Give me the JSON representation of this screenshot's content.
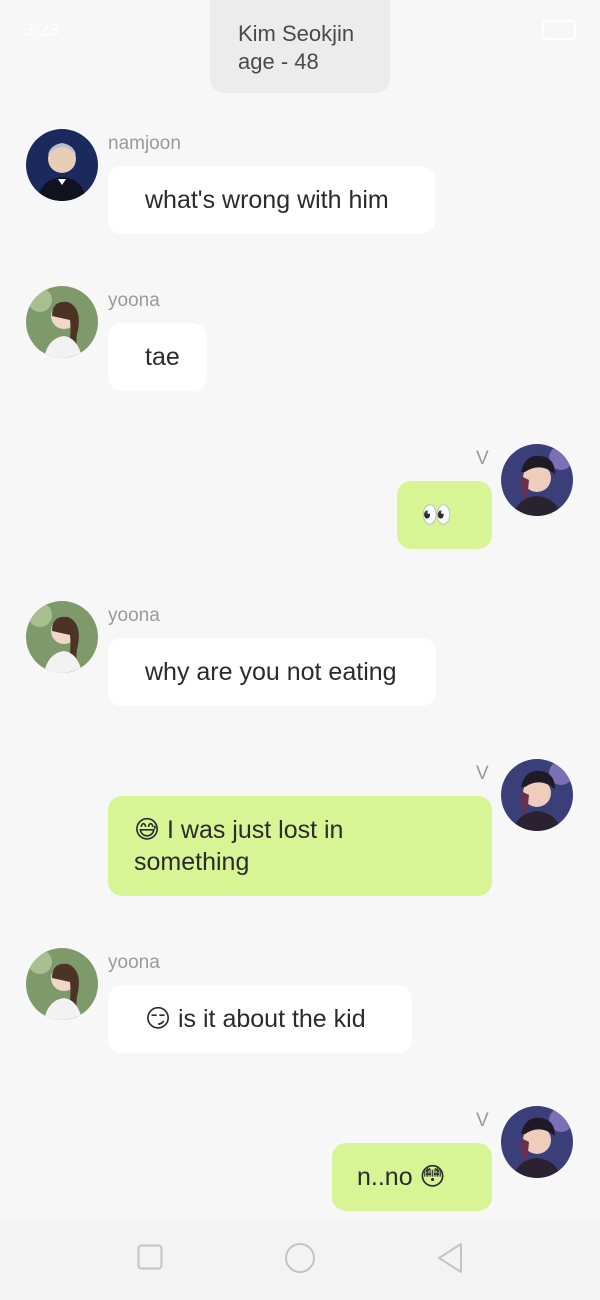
{
  "status_bar": {
    "time": "3:23"
  },
  "header": {
    "name": "Kim Seokjin",
    "age": "age - 48"
  },
  "messages": [
    {
      "sender": "namjoon",
      "text": "what's wrong with him",
      "side": "left"
    },
    {
      "sender": "yoona",
      "text": "tae",
      "side": "left"
    },
    {
      "sender": "V",
      "text": "👀",
      "side": "right"
    },
    {
      "sender": "yoona",
      "text": "why are you not eating",
      "side": "left"
    },
    {
      "sender": "V",
      "text": "😅 I was just lost in something",
      "side": "right"
    },
    {
      "sender": "yoona",
      "text": "😏 is it about the kid",
      "side": "left"
    },
    {
      "sender": "V",
      "text": "n..no 😳",
      "side": "right"
    }
  ],
  "colors": {
    "background": "#f7f7f7",
    "incoming_bubble": "#ffffff",
    "outgoing_bubble": "#d8f596",
    "sender_text": "#9a9a9a"
  },
  "nav": {
    "icons": [
      "square-icon",
      "circle-icon",
      "back-triangle-icon"
    ]
  }
}
